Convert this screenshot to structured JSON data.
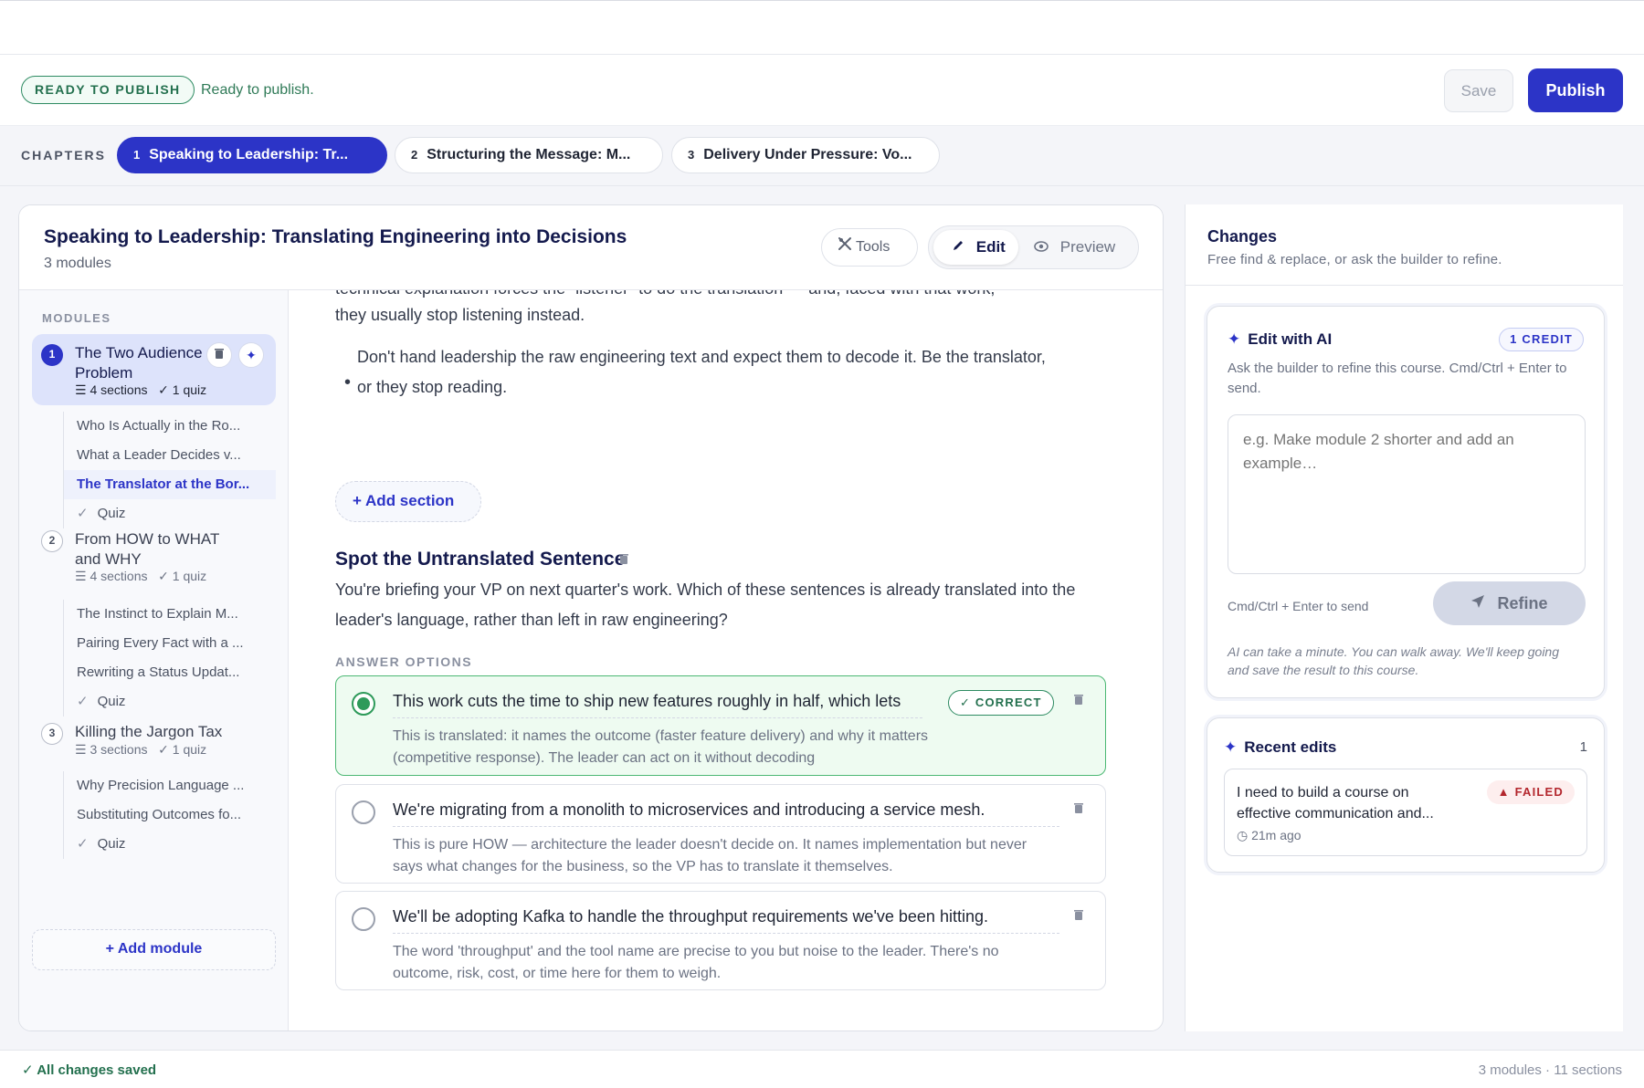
{
  "status": {
    "badge": "READY TO PUBLISH",
    "text": "Ready to publish.",
    "save_label": "Save",
    "publish_label": "Publish"
  },
  "chapters": {
    "label": "CHAPTERS",
    "tabs": [
      {
        "num": "1",
        "label": "Speaking to Leadership: Tr..."
      },
      {
        "num": "2",
        "label": "Structuring the Message: M..."
      },
      {
        "num": "3",
        "label": "Delivery Under Pressure: Vo..."
      }
    ]
  },
  "chapter": {
    "title": "Speaking to Leadership: Translating Engineering into Decisions",
    "subtitle": "3 modules",
    "tools_label": "Tools",
    "edit_label": "Edit",
    "preview_label": "Preview"
  },
  "sidebar": {
    "label": "MODULES",
    "modules": [
      {
        "num": "1",
        "title": "The Two Audience Problem",
        "sections": "4 sections",
        "quiz": "1 quiz",
        "items": [
          "Who Is Actually in the Ro...",
          "What a Leader Decides v...",
          "The Translator at the Bor...",
          "Quiz"
        ]
      },
      {
        "num": "2",
        "title": "From HOW to WHAT and WHY",
        "sections": "4 sections",
        "quiz": "1 quiz",
        "items": [
          "The Instinct to Explain M...",
          "Pairing Every Fact with a ...",
          "Rewriting a Status Updat...",
          "Quiz"
        ]
      },
      {
        "num": "3",
        "title": "Killing the Jargon Tax",
        "sections": "3 sections",
        "quiz": "1 quiz",
        "items": [
          "Why Precision Language ...",
          "Substituting Outcomes fo...",
          "Quiz"
        ]
      }
    ],
    "add_module": "Add module"
  },
  "content": {
    "cut_line": "technical explanation forces the “listener” to do the translation — and, faced with that work,",
    "para_end": "they usually stop listening instead.",
    "bullet": "Don't hand leadership the raw engineering text and expect them to decode it. Be the translator, or they stop reading.",
    "add_section": "Add section",
    "section_title": "Spot the Untranslated Sentence",
    "question": "You're briefing your VP on next quarter's work. Which of these sentences is already translated into the leader's language, rather than left in raw engineering?",
    "answers_label": "ANSWER OPTIONS",
    "correct_badge": "CORRECT",
    "answers": [
      {
        "text": "This work cuts the time to ship new features roughly in half, which lets",
        "explanation": "This is translated: it names the outcome (faster feature delivery) and why it matters (competitive response). The leader can act on it without decoding"
      },
      {
        "text": "We're migrating from a monolith to microservices and introducing a service mesh.",
        "explanation": "This is pure HOW — architecture the leader doesn't decide on. It names implementation but never says what changes for the business, so the VP has to translate it themselves."
      },
      {
        "text": "We'll be adopting Kafka to handle the throughput requirements we've been hitting.",
        "explanation": "The word 'throughput' and the tool name are precise to you but noise to the leader. There's no outcome, risk, cost, or time here for them to weigh."
      }
    ]
  },
  "changes": {
    "title": "Changes",
    "subtitle": "Free find & replace, or ask the builder to refine.",
    "ai": {
      "title": "Edit with AI",
      "credit": "1 CREDIT",
      "description": "Ask the builder to refine this course. Cmd/Ctrl + Enter to send.",
      "placeholder": "e.g. Make module 2 shorter and add an example…",
      "hint": "Cmd/Ctrl + Enter to send",
      "refine_label": "Refine",
      "note": "AI can take a minute. You can walk away. We'll keep going and save the result to this course."
    },
    "recent": {
      "title": "Recent edits",
      "count": "1",
      "item_text": "I need to build a course on effective communication and...",
      "item_status": "FAILED",
      "item_time": "21m ago"
    }
  },
  "footer": {
    "saved": "All changes saved",
    "stats": "3 modules · 11 sections"
  },
  "colors": {
    "accent": "#2c34c7",
    "success": "#2e8b62",
    "danger": "#b3262d"
  }
}
